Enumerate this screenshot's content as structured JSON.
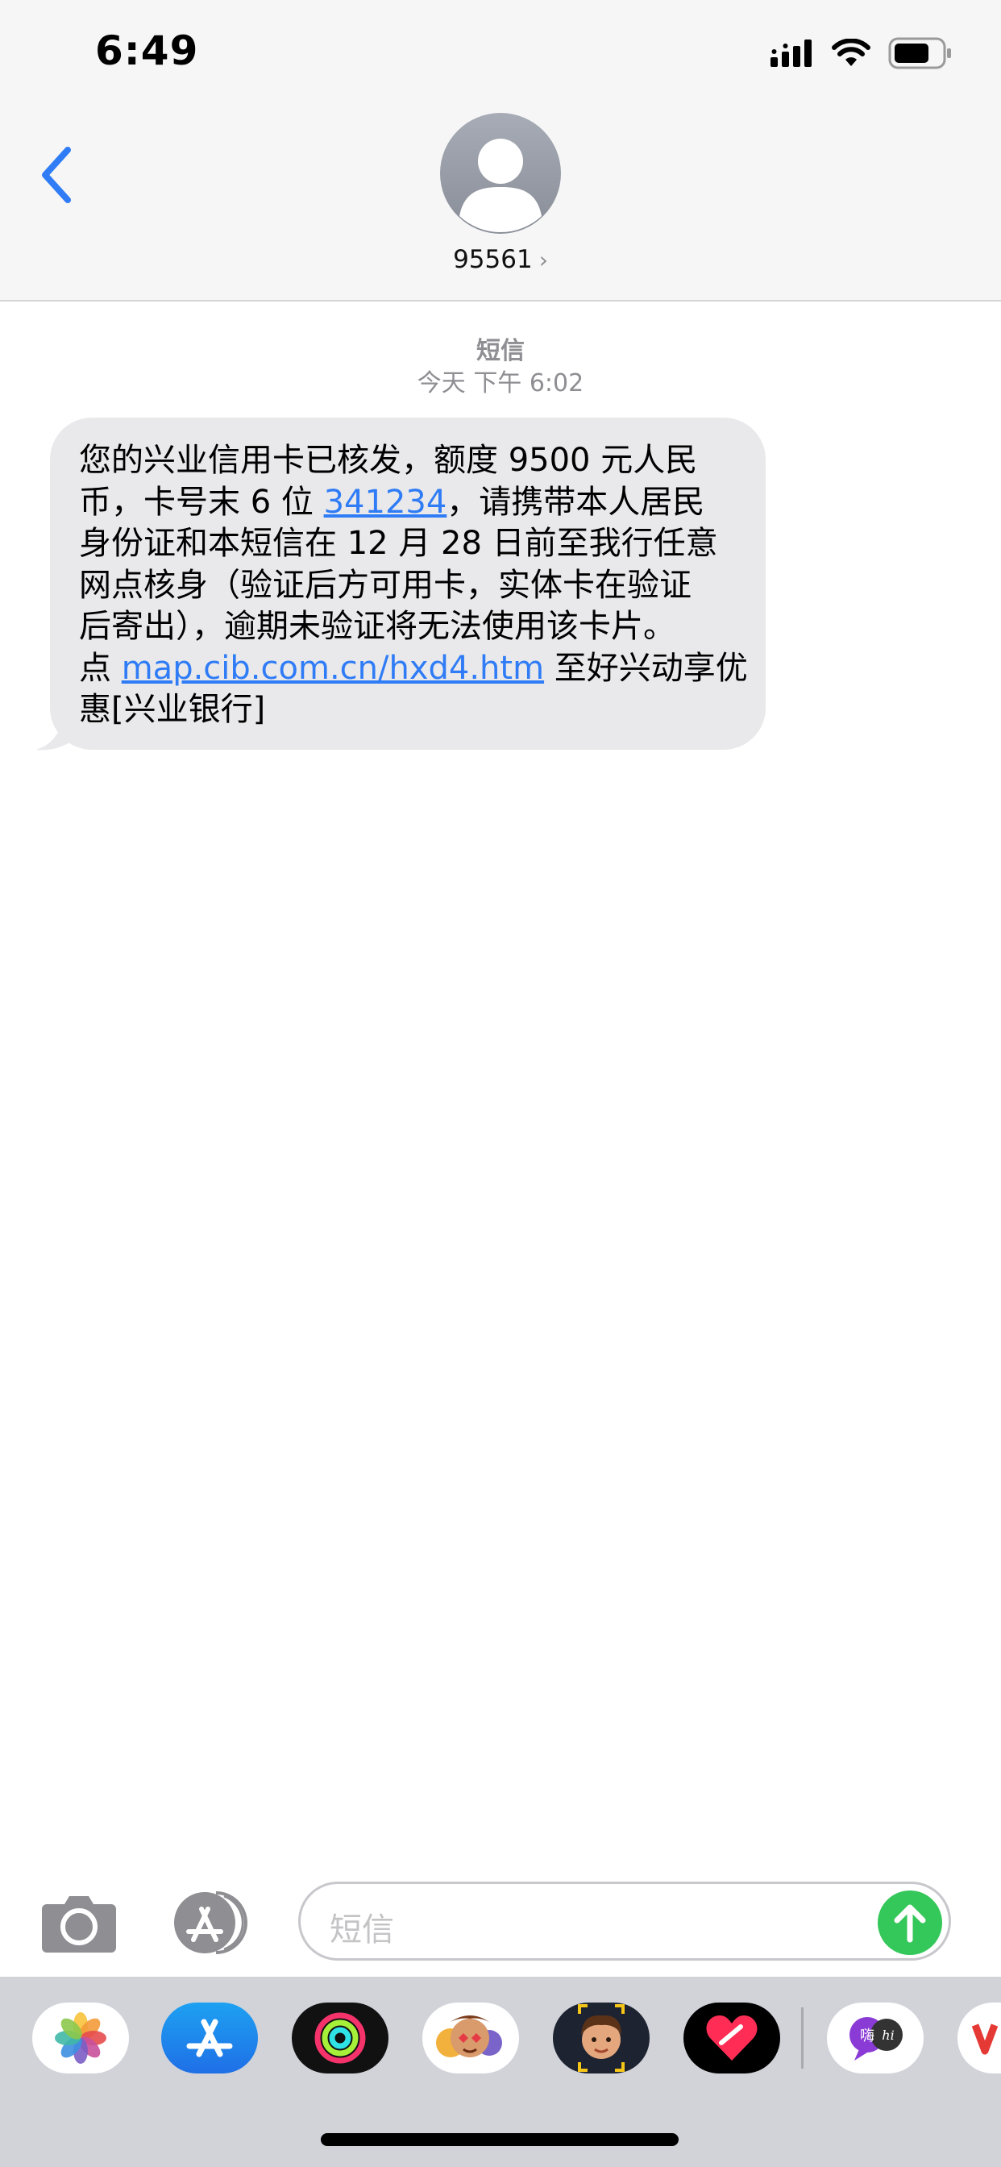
{
  "status_bar": {
    "time": "6:49"
  },
  "header": {
    "contact": "95561",
    "chevron": "›"
  },
  "conversation": {
    "service": "短信",
    "day": "今天",
    "time": "下午 6:02",
    "message": {
      "l1": "您的兴业信用卡已核发，额度 9500 元人民",
      "l2_pre": "币，卡号末 6 位 ",
      "l2_link": "341234",
      "l2_post": "，请携带本人居民",
      "l3": "身份证和本短信在 12 月 28 日前至我行任意",
      "l4": "网点核身（验证后方可用卡，实体卡在验证",
      "l5": "后寄出），逾期未验证将无法使用该卡片。",
      "l6_pre": "点 ",
      "l6_link": "map.cib.com.cn/hxd4.htm",
      "l6_post": " 至好兴动享优",
      "l7": "惠[兴业银行]"
    }
  },
  "composer": {
    "placeholder": "短信"
  },
  "app_drawer": {
    "apps": [
      "photos-icon",
      "app-store-icon",
      "activity-icon",
      "memoji-stickers-icon",
      "memoji-icon",
      "digital-touch-icon",
      "hi-app-icon",
      "partial-app-icon"
    ],
    "chat_app_labels": {
      "left": "嗨",
      "right": "hi"
    }
  },
  "colors": {
    "link": "#2f7cf6",
    "send": "#34c759",
    "bubble": "#e9e9eb",
    "accent": "#2f7cf6"
  }
}
